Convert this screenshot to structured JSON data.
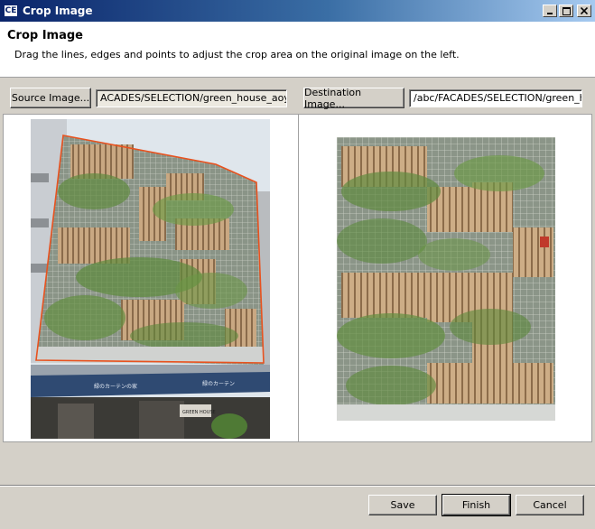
{
  "window": {
    "logo_text": "CE",
    "title": "Crop Image"
  },
  "header": {
    "title": "Crop Image",
    "description": "Drag the lines, edges and points to adjust the crop area on the original image on the left."
  },
  "toolbar": {
    "source_button": "Source Image...",
    "source_path": "ACADES/SELECTION/green_house_aoyan",
    "destination_button": "Destination Image...",
    "destination_path": "/abc/FACADES/SELECTION/green_ho"
  },
  "footer": {
    "save_label": "Save",
    "finish_label": "Finish",
    "cancel_label": "Cancel"
  },
  "source_image": {
    "sign_left": "緑のカーテンの家",
    "sign_right": "緑のカーテン",
    "shop_sign": "GREEN HOUSE"
  },
  "colors": {
    "crop_outline": "#e8521f",
    "title_gradient_start": "#0a246a",
    "title_gradient_end": "#a6caf0"
  }
}
